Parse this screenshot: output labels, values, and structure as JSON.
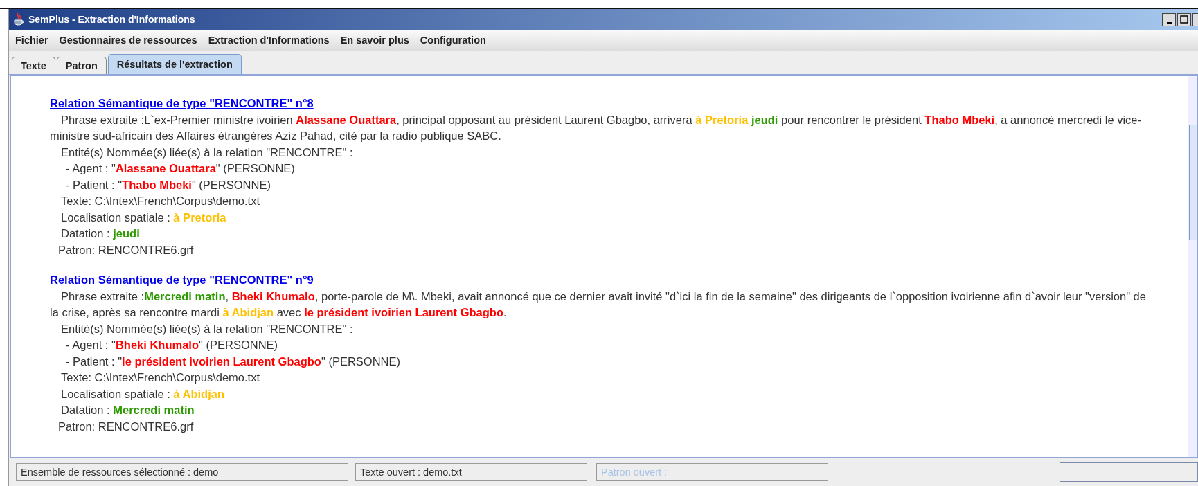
{
  "window": {
    "title": "SemPlus - Extraction d'Informations"
  },
  "menu": [
    "Fichier",
    "Gestionnaires de ressources",
    "Extraction d'Informations",
    "En savoir plus",
    "Configuration"
  ],
  "tabs": [
    {
      "label": "Texte",
      "selected": false
    },
    {
      "label": "Patron",
      "selected": false
    },
    {
      "label": "Résultats de l'extraction",
      "selected": true
    }
  ],
  "results": [
    {
      "lines": [
        {
          "kind": "heading",
          "parts": [
            {
              "kind": "plain",
              "text": "Relation Sémantique de type \"RENCONTRE\" n°8"
            }
          ]
        },
        {
          "kind": "sentence",
          "parts": [
            {
              "kind": "plain",
              "text": "Phrase extraite :L`ex-Premier ministre ivoirien "
            },
            {
              "kind": "person",
              "text": "Alassane Ouattara"
            },
            {
              "kind": "plain",
              "text": ", principal opposant au président Laurent Gbagbo, arrivera "
            },
            {
              "kind": "place",
              "text": "à Pretoria "
            },
            {
              "kind": "time",
              "text": "jeudi"
            },
            {
              "kind": "plain",
              "text": " pour rencontrer le président "
            },
            {
              "kind": "person",
              "text": "Thabo Mbeki"
            },
            {
              "kind": "plain",
              "text": ", a annoncé mercredi le vice-ministre sud-africain des Affaires étrangères Aziz Pahad, cité par la radio publique SABC."
            }
          ]
        },
        {
          "kind": "entry",
          "parts": [
            {
              "kind": "plain",
              "text": "Entité(s) Nommée(s) liée(s) à la relation \"RENCONTRE\" :"
            }
          ]
        },
        {
          "kind": "sub",
          "parts": [
            {
              "kind": "plain",
              "text": "- Agent : \""
            },
            {
              "kind": "person",
              "text": "Alassane Ouattara"
            },
            {
              "kind": "plain",
              "text": "\" (PERSONNE)"
            }
          ]
        },
        {
          "kind": "sub",
          "parts": [
            {
              "kind": "plain",
              "text": "- Patient : \""
            },
            {
              "kind": "person",
              "text": "Thabo Mbeki"
            },
            {
              "kind": "plain",
              "text": "\" (PERSONNE)"
            }
          ]
        },
        {
          "kind": "entry",
          "parts": [
            {
              "kind": "plain",
              "text": "Texte: C:\\Intex\\French\\Corpus\\demo.txt"
            }
          ]
        },
        {
          "kind": "entry",
          "parts": [
            {
              "kind": "plain",
              "text": "Localisation spatiale : "
            },
            {
              "kind": "place",
              "text": "à Pretoria"
            }
          ]
        },
        {
          "kind": "entry",
          "parts": [
            {
              "kind": "plain",
              "text": "Datation : "
            },
            {
              "kind": "time",
              "text": "jeudi"
            }
          ]
        },
        {
          "kind": "patron",
          "parts": [
            {
              "kind": "plain",
              "text": "Patron: RENCONTRE6.grf"
            }
          ]
        }
      ]
    },
    {
      "lines": [
        {
          "kind": "heading",
          "parts": [
            {
              "kind": "plain",
              "text": "Relation Sémantique de type \"RENCONTRE\" n°9"
            }
          ]
        },
        {
          "kind": "sentence",
          "parts": [
            {
              "kind": "plain",
              "text": "Phrase extraite :"
            },
            {
              "kind": "time",
              "text": "Mercredi matin"
            },
            {
              "kind": "plain",
              "text": ", "
            },
            {
              "kind": "person",
              "text": "Bheki Khumalo"
            },
            {
              "kind": "plain",
              "text": ", porte-parole de M\\. Mbeki, avait annoncé que ce dernier avait invité \"d`ici la fin de la semaine\" des dirigeants de l`opposition ivoirienne afin d`avoir leur \"version\" de la crise, après sa rencontre mardi "
            },
            {
              "kind": "place",
              "text": "à Abidjan"
            },
            {
              "kind": "plain",
              "text": " avec "
            },
            {
              "kind": "person",
              "text": "le président ivoirien Laurent Gbagbo"
            },
            {
              "kind": "plain",
              "text": "."
            }
          ]
        },
        {
          "kind": "entry",
          "parts": [
            {
              "kind": "plain",
              "text": "Entité(s) Nommée(s) liée(s) à la relation \"RENCONTRE\" :"
            }
          ]
        },
        {
          "kind": "sub",
          "parts": [
            {
              "kind": "plain",
              "text": "- Agent : \""
            },
            {
              "kind": "person",
              "text": "Bheki Khumalo"
            },
            {
              "kind": "plain",
              "text": "\" (PERSONNE)"
            }
          ]
        },
        {
          "kind": "sub",
          "parts": [
            {
              "kind": "plain",
              "text": "- Patient : \""
            },
            {
              "kind": "person",
              "text": "le président ivoirien Laurent Gbagbo"
            },
            {
              "kind": "plain",
              "text": "\" (PERSONNE)"
            }
          ]
        },
        {
          "kind": "entry",
          "parts": [
            {
              "kind": "plain",
              "text": "Texte: C:\\Intex\\French\\Corpus\\demo.txt"
            }
          ]
        },
        {
          "kind": "entry",
          "parts": [
            {
              "kind": "plain",
              "text": "Localisation spatiale : "
            },
            {
              "kind": "place",
              "text": "à Abidjan"
            }
          ]
        },
        {
          "kind": "entry",
          "parts": [
            {
              "kind": "plain",
              "text": "Datation : "
            },
            {
              "kind": "time",
              "text": "Mercredi matin"
            }
          ]
        },
        {
          "kind": "patron",
          "parts": [
            {
              "kind": "plain",
              "text": "Patron: RENCONTRE6.grf"
            }
          ]
        }
      ]
    }
  ],
  "status_bar": [
    {
      "text": "Ensemble de ressources sélectionné : demo",
      "disabled": false
    },
    {
      "text": "Texte ouvert : demo.txt",
      "disabled": false
    },
    {
      "text": "Patron ouvert :",
      "disabled": true
    }
  ]
}
